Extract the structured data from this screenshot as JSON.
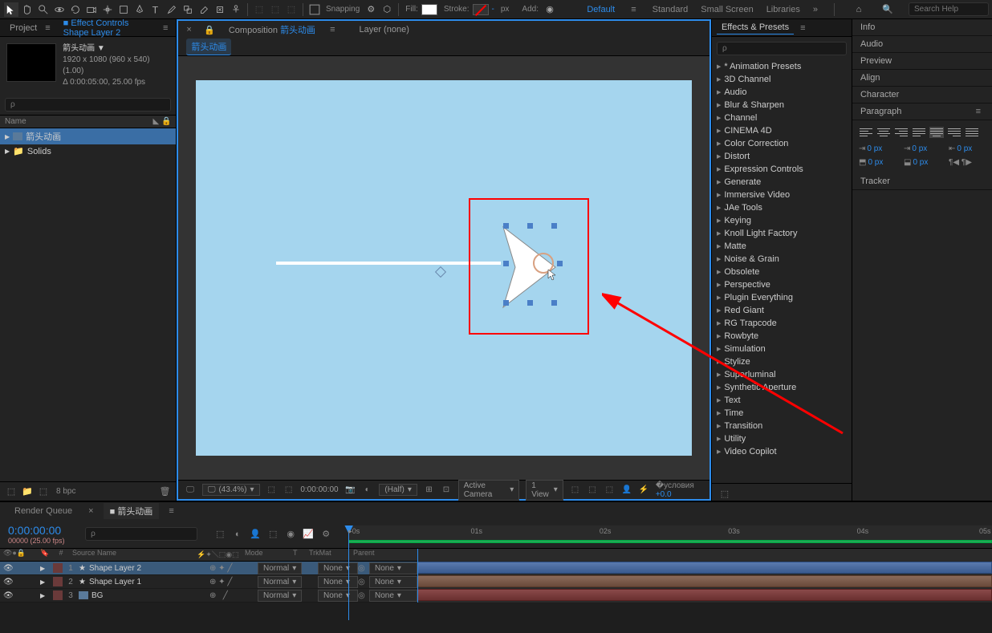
{
  "toolbar": {
    "snapping": "Snapping",
    "fill_label": "Fill:",
    "stroke_label": "Stroke:",
    "stroke_px": "px",
    "add_label": "Add: ",
    "search_placeholder": "Search Help"
  },
  "workspaces": {
    "default": "Default",
    "standard": "Standard",
    "small": "Small Screen",
    "libraries": "Libraries"
  },
  "project": {
    "tab_project": "Project",
    "tab_effect_controls": "Effect Controls Shape Layer 2",
    "comp_name": "箭头动画 ▼",
    "comp_res": "1920 x 1080  (960 x 540) (1.00)",
    "comp_dur": "Δ 0:00:05:00, 25.00 fps",
    "search_placeholder": "ρ",
    "col_name": "Name",
    "items": [
      "箭头动画",
      "Solids"
    ],
    "bpc": "8 bpc"
  },
  "viewer": {
    "tab_composition": "Composition",
    "comp_name": "箭头动画",
    "layer_none": "Layer (none)",
    "subtab": "箭头动画",
    "zoom": "(43.4%)",
    "timecode": "0:00:00:00",
    "resolution": "(Half)",
    "camera": "Active Camera",
    "view": "1 View",
    "exposure": "+0.0"
  },
  "effects": {
    "title": "Effects & Presets",
    "search_placeholder": "ρ",
    "items": [
      "* Animation Presets",
      "3D Channel",
      "Audio",
      "Blur & Sharpen",
      "Channel",
      "CINEMA 4D",
      "Color Correction",
      "Distort",
      "Expression Controls",
      "Generate",
      "Immersive Video",
      "JAe Tools",
      "Keying",
      "Knoll Light Factory",
      "Matte",
      "Noise & Grain",
      "Obsolete",
      "Perspective",
      "Plugin Everything",
      "Red Giant",
      "RG Trapcode",
      "Rowbyte",
      "Simulation",
      "Stylize",
      "Superluminal",
      "Synthetic Aperture",
      "Text",
      "Time",
      "Transition",
      "Utility",
      "Video Copilot"
    ]
  },
  "right_panels": {
    "info": "Info",
    "audio": "Audio",
    "preview": "Preview",
    "align": "Align",
    "character": "Character",
    "paragraph": "Paragraph",
    "tracker": "Tracker",
    "indent_value": "0 px"
  },
  "timeline": {
    "tab_render": "Render Queue",
    "tab_comp": "箭头动画",
    "current_time": "0:00:00:00",
    "frame_info": "00000 (25.00 fps)",
    "col_num": "#",
    "col_source": "Source Name",
    "col_mode": "Mode",
    "col_t": "T",
    "col_trkmat": "TrkMat",
    "col_parent": "Parent",
    "mode_normal": "Normal",
    "trkmat_none": "None",
    "parent_none": "None",
    "layers": [
      {
        "num": "1",
        "name": "Shape Layer 2",
        "color": "#d04040"
      },
      {
        "num": "2",
        "name": "Shape Layer 1",
        "color": "#d04040"
      },
      {
        "num": "3",
        "name": "BG",
        "color": "#d04040"
      }
    ],
    "ticks": [
      "01s",
      "02s",
      "03s",
      "04s",
      "05s"
    ]
  }
}
